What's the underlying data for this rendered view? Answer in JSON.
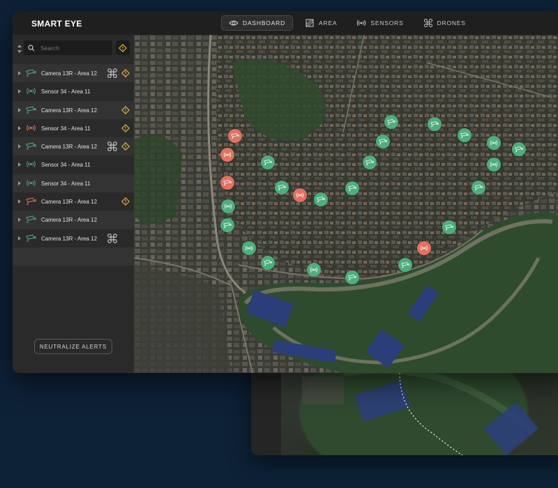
{
  "app": {
    "title": "SMART EYE"
  },
  "nav": [
    {
      "label": "DASHBOARD",
      "icon": "eye-icon",
      "active": true
    },
    {
      "label": "AREA",
      "icon": "area-icon",
      "active": false
    },
    {
      "label": "SENSORS",
      "icon": "sensor-icon",
      "active": false
    },
    {
      "label": "DRONES",
      "icon": "drone-icon",
      "active": false
    }
  ],
  "search": {
    "placeholder": "Search",
    "value": ""
  },
  "devices": [
    {
      "label": "Camera 13R - Area 12",
      "type": "camera",
      "status": "ok",
      "drone": true,
      "warning": true
    },
    {
      "label": "Sensor 34 - Area 11",
      "type": "sensor",
      "status": "ok",
      "drone": false,
      "warning": false
    },
    {
      "label": "Camera 13R - Area 12",
      "type": "camera",
      "status": "ok",
      "drone": false,
      "warning": true
    },
    {
      "label": "Sensor 34 - Area 11",
      "type": "sensor",
      "status": "alert",
      "drone": false,
      "warning": true
    },
    {
      "label": "Camera 13R - Area 12",
      "type": "camera",
      "status": "ok",
      "drone": true,
      "warning": true
    },
    {
      "label": "Sensor 34 - Area 11",
      "type": "sensor",
      "status": "ok",
      "drone": false,
      "warning": false
    },
    {
      "label": "Sensor 34 - Area 11",
      "type": "sensor",
      "status": "ok",
      "drone": false,
      "warning": false
    },
    {
      "label": "Camera 13R - Area 12",
      "type": "camera",
      "status": "alert",
      "drone": false,
      "warning": true
    },
    {
      "label": "Camera 13R - Area 12",
      "type": "camera",
      "status": "ok",
      "drone": false,
      "warning": false
    },
    {
      "label": "Camera 13R - Area 12",
      "type": "camera",
      "status": "ok",
      "drone": true,
      "warning": false
    }
  ],
  "actions": {
    "neutralize_label": "NEUTRALIZE ALERTS"
  },
  "colors": {
    "ok": "#4fae7e",
    "alert": "#e0725f",
    "warning": "#e8b53a",
    "background": "#0d2137",
    "panel": "#2a2a2a"
  }
}
